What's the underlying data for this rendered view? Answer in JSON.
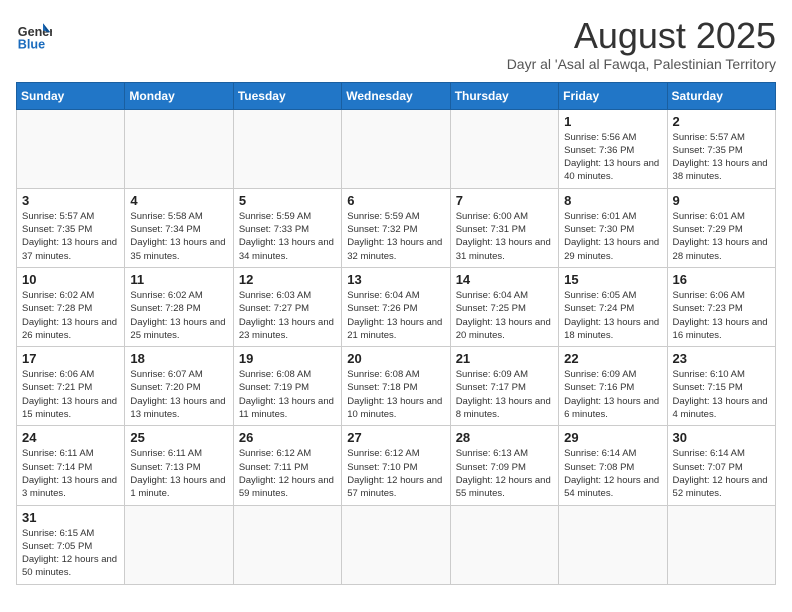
{
  "logo": {
    "text_general": "General",
    "text_blue": "Blue"
  },
  "title": "August 2025",
  "subtitle": "Dayr al 'Asal al Fawqa, Palestinian Territory",
  "weekdays": [
    "Sunday",
    "Monday",
    "Tuesday",
    "Wednesday",
    "Thursday",
    "Friday",
    "Saturday"
  ],
  "weeks": [
    [
      {
        "day": "",
        "info": ""
      },
      {
        "day": "",
        "info": ""
      },
      {
        "day": "",
        "info": ""
      },
      {
        "day": "",
        "info": ""
      },
      {
        "day": "",
        "info": ""
      },
      {
        "day": "1",
        "info": "Sunrise: 5:56 AM\nSunset: 7:36 PM\nDaylight: 13 hours and 40 minutes."
      },
      {
        "day": "2",
        "info": "Sunrise: 5:57 AM\nSunset: 7:35 PM\nDaylight: 13 hours and 38 minutes."
      }
    ],
    [
      {
        "day": "3",
        "info": "Sunrise: 5:57 AM\nSunset: 7:35 PM\nDaylight: 13 hours and 37 minutes."
      },
      {
        "day": "4",
        "info": "Sunrise: 5:58 AM\nSunset: 7:34 PM\nDaylight: 13 hours and 35 minutes."
      },
      {
        "day": "5",
        "info": "Sunrise: 5:59 AM\nSunset: 7:33 PM\nDaylight: 13 hours and 34 minutes."
      },
      {
        "day": "6",
        "info": "Sunrise: 5:59 AM\nSunset: 7:32 PM\nDaylight: 13 hours and 32 minutes."
      },
      {
        "day": "7",
        "info": "Sunrise: 6:00 AM\nSunset: 7:31 PM\nDaylight: 13 hours and 31 minutes."
      },
      {
        "day": "8",
        "info": "Sunrise: 6:01 AM\nSunset: 7:30 PM\nDaylight: 13 hours and 29 minutes."
      },
      {
        "day": "9",
        "info": "Sunrise: 6:01 AM\nSunset: 7:29 PM\nDaylight: 13 hours and 28 minutes."
      }
    ],
    [
      {
        "day": "10",
        "info": "Sunrise: 6:02 AM\nSunset: 7:28 PM\nDaylight: 13 hours and 26 minutes."
      },
      {
        "day": "11",
        "info": "Sunrise: 6:02 AM\nSunset: 7:28 PM\nDaylight: 13 hours and 25 minutes."
      },
      {
        "day": "12",
        "info": "Sunrise: 6:03 AM\nSunset: 7:27 PM\nDaylight: 13 hours and 23 minutes."
      },
      {
        "day": "13",
        "info": "Sunrise: 6:04 AM\nSunset: 7:26 PM\nDaylight: 13 hours and 21 minutes."
      },
      {
        "day": "14",
        "info": "Sunrise: 6:04 AM\nSunset: 7:25 PM\nDaylight: 13 hours and 20 minutes."
      },
      {
        "day": "15",
        "info": "Sunrise: 6:05 AM\nSunset: 7:24 PM\nDaylight: 13 hours and 18 minutes."
      },
      {
        "day": "16",
        "info": "Sunrise: 6:06 AM\nSunset: 7:23 PM\nDaylight: 13 hours and 16 minutes."
      }
    ],
    [
      {
        "day": "17",
        "info": "Sunrise: 6:06 AM\nSunset: 7:21 PM\nDaylight: 13 hours and 15 minutes."
      },
      {
        "day": "18",
        "info": "Sunrise: 6:07 AM\nSunset: 7:20 PM\nDaylight: 13 hours and 13 minutes."
      },
      {
        "day": "19",
        "info": "Sunrise: 6:08 AM\nSunset: 7:19 PM\nDaylight: 13 hours and 11 minutes."
      },
      {
        "day": "20",
        "info": "Sunrise: 6:08 AM\nSunset: 7:18 PM\nDaylight: 13 hours and 10 minutes."
      },
      {
        "day": "21",
        "info": "Sunrise: 6:09 AM\nSunset: 7:17 PM\nDaylight: 13 hours and 8 minutes."
      },
      {
        "day": "22",
        "info": "Sunrise: 6:09 AM\nSunset: 7:16 PM\nDaylight: 13 hours and 6 minutes."
      },
      {
        "day": "23",
        "info": "Sunrise: 6:10 AM\nSunset: 7:15 PM\nDaylight: 13 hours and 4 minutes."
      }
    ],
    [
      {
        "day": "24",
        "info": "Sunrise: 6:11 AM\nSunset: 7:14 PM\nDaylight: 13 hours and 3 minutes."
      },
      {
        "day": "25",
        "info": "Sunrise: 6:11 AM\nSunset: 7:13 PM\nDaylight: 13 hours and 1 minute."
      },
      {
        "day": "26",
        "info": "Sunrise: 6:12 AM\nSunset: 7:11 PM\nDaylight: 12 hours and 59 minutes."
      },
      {
        "day": "27",
        "info": "Sunrise: 6:12 AM\nSunset: 7:10 PM\nDaylight: 12 hours and 57 minutes."
      },
      {
        "day": "28",
        "info": "Sunrise: 6:13 AM\nSunset: 7:09 PM\nDaylight: 12 hours and 55 minutes."
      },
      {
        "day": "29",
        "info": "Sunrise: 6:14 AM\nSunset: 7:08 PM\nDaylight: 12 hours and 54 minutes."
      },
      {
        "day": "30",
        "info": "Sunrise: 6:14 AM\nSunset: 7:07 PM\nDaylight: 12 hours and 52 minutes."
      }
    ],
    [
      {
        "day": "31",
        "info": "Sunrise: 6:15 AM\nSunset: 7:05 PM\nDaylight: 12 hours and 50 minutes."
      },
      {
        "day": "",
        "info": ""
      },
      {
        "day": "",
        "info": ""
      },
      {
        "day": "",
        "info": ""
      },
      {
        "day": "",
        "info": ""
      },
      {
        "day": "",
        "info": ""
      },
      {
        "day": "",
        "info": ""
      }
    ]
  ]
}
